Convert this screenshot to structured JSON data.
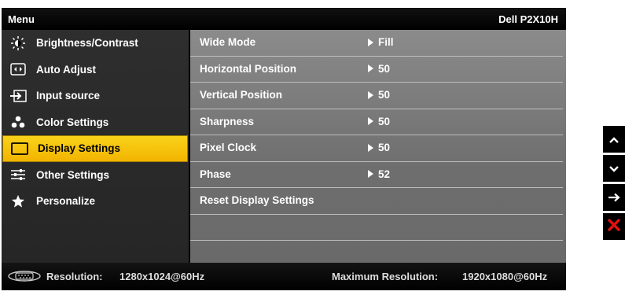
{
  "header": {
    "menu": "Menu",
    "model": "Dell P2X10H"
  },
  "left_menu": [
    {
      "label": "Brightness/Contrast",
      "icon": "brightness-icon",
      "selected": false
    },
    {
      "label": "Auto Adjust",
      "icon": "auto-adjust-icon",
      "selected": false
    },
    {
      "label": "Input source",
      "icon": "input-source-icon",
      "selected": false
    },
    {
      "label": "Color Settings",
      "icon": "color-settings-icon",
      "selected": false
    },
    {
      "label": "Display Settings",
      "icon": "display-settings-icon",
      "selected": true
    },
    {
      "label": "Other Settings",
      "icon": "other-settings-icon",
      "selected": false
    },
    {
      "label": "Personalize",
      "icon": "star-icon",
      "selected": false
    }
  ],
  "settings": [
    {
      "label": "Wide Mode",
      "value": "Fill"
    },
    {
      "label": "Horizontal Position",
      "value": "50"
    },
    {
      "label": "Vertical Position",
      "value": "50"
    },
    {
      "label": "Sharpness",
      "value": "50"
    },
    {
      "label": "Pixel Clock",
      "value": "50"
    },
    {
      "label": "Phase",
      "value": "52"
    },
    {
      "label": "Reset Display Settings",
      "value": ""
    }
  ],
  "footer": {
    "resolution_label": "Resolution:",
    "resolution_value": "1280x1024@60Hz",
    "max_label": "Maximum Resolution:",
    "max_value": "1920x1080@60Hz"
  },
  "side_buttons": [
    {
      "name": "up-button",
      "glyph": "^"
    },
    {
      "name": "down-button",
      "glyph": "v"
    },
    {
      "name": "enter-button",
      "glyph": "→"
    },
    {
      "name": "exit-button",
      "glyph": "✕"
    }
  ],
  "colors": {
    "accent": "#f5c000",
    "exit": "#e11111",
    "panel": "#7a7a7a"
  }
}
